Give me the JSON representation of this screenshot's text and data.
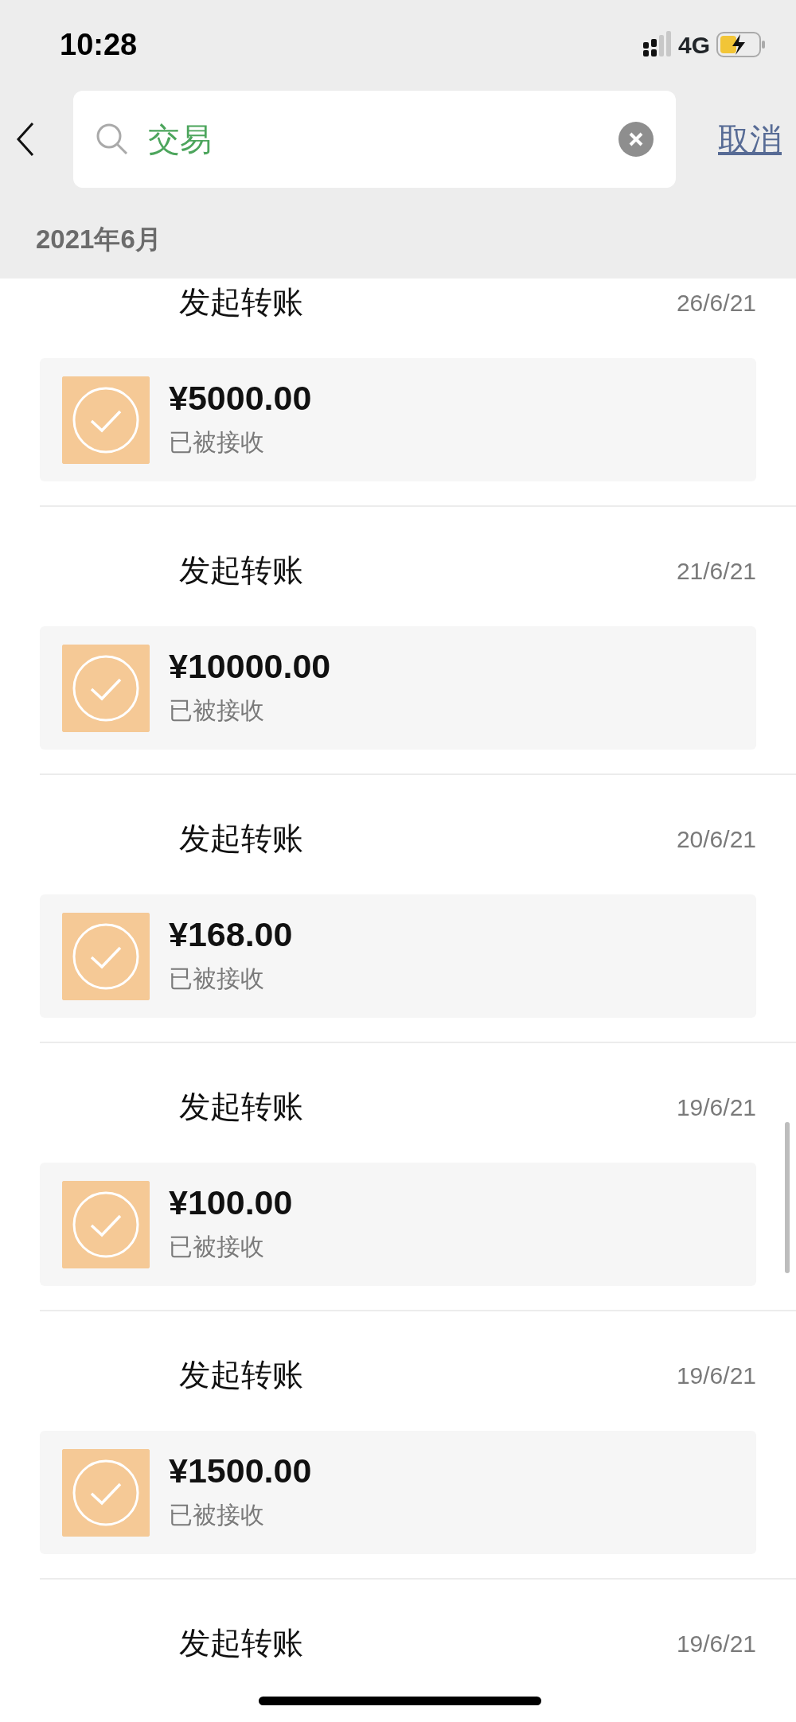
{
  "status_bar": {
    "time": "10:28",
    "network": "4G"
  },
  "search": {
    "value": "交易",
    "cancel": "取消"
  },
  "section_header": "2021年6月",
  "transactions": [
    {
      "title": "发起转账",
      "date": "26/6/21",
      "amount": "¥5000.00",
      "status": "已被接收"
    },
    {
      "title": "发起转账",
      "date": "21/6/21",
      "amount": "¥10000.00",
      "status": "已被接收"
    },
    {
      "title": "发起转账",
      "date": "20/6/21",
      "amount": "¥168.00",
      "status": "已被接收"
    },
    {
      "title": "发起转账",
      "date": "19/6/21",
      "amount": "¥100.00",
      "status": "已被接收"
    },
    {
      "title": "发起转账",
      "date": "19/6/21",
      "amount": "¥1500.00",
      "status": "已被接收"
    },
    {
      "title": "发起转账",
      "date": "19/6/21"
    }
  ]
}
